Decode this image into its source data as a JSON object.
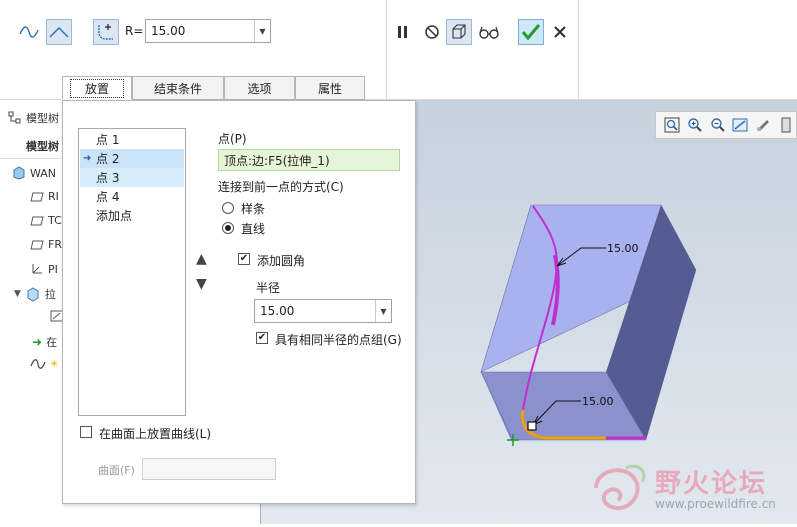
{
  "toolbar": {
    "r_label": "R=",
    "r_value": "15.00",
    "icons": [
      "spline-icon",
      "line-icon",
      "fillet-icon",
      "pause-icon",
      "no-preview-icon",
      "verify-icon",
      "glasses-icon",
      "ok-icon",
      "cancel-icon"
    ]
  },
  "tabs": [
    {
      "label": "放置",
      "active": true
    },
    {
      "label": "结束条件",
      "active": false
    },
    {
      "label": "选项",
      "active": false
    },
    {
      "label": "属性",
      "active": false
    }
  ],
  "model_tree": {
    "title": "模型树",
    "title2": "模型树",
    "items": [
      "WAN",
      "RI",
      "TC",
      "FR",
      "PI",
      "拉",
      "",
      "在",
      ""
    ]
  },
  "panel": {
    "points": [
      "点 1",
      "点 2",
      "点 3",
      "点 4",
      "添加点"
    ],
    "selected_index": 1,
    "point_label": "点(P)",
    "point_value": "顶点:边:F5(拉伸_1)",
    "connect_label": "连接到前一点的方式(C)",
    "spline_label": "样条",
    "line_label": "直线",
    "add_fillet_label": "添加圆角",
    "radius_label": "半径",
    "radius_value": "15.00",
    "same_radius_label": "具有相同半径的点组(G)",
    "on_surface_label": "在曲面上放置曲线(L)",
    "surface_label": "曲面(F)"
  },
  "graphics": {
    "dim_top": "15.00",
    "dim_bottom": "15.00"
  },
  "watermark": {
    "text": "野火论坛",
    "url": "www.proewildfire.cn"
  },
  "colors": {
    "box_top": "#a9b1ee",
    "box_front": "#8088c7",
    "box_side": "#555c93",
    "curve_magenta": "#c030d0",
    "curve_orange": "#f0a000"
  }
}
